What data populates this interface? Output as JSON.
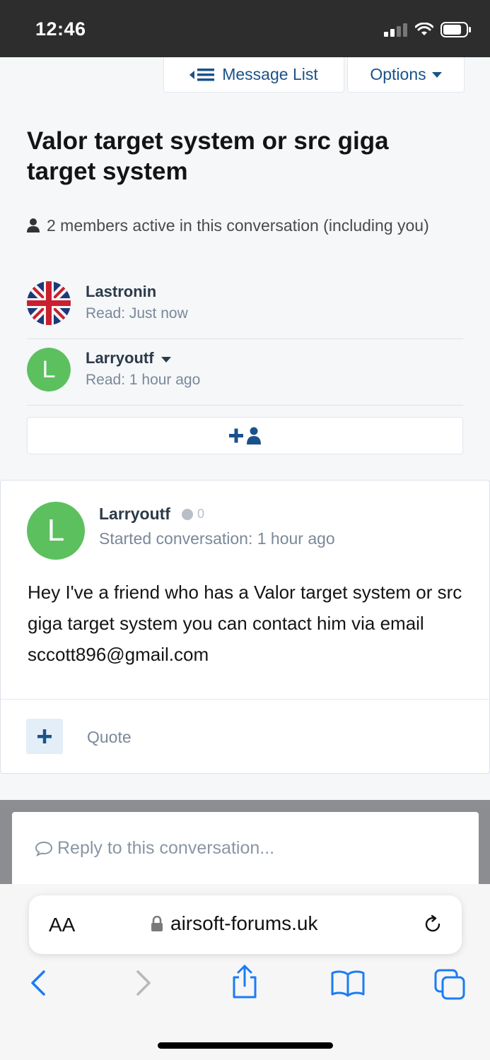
{
  "status_bar": {
    "time": "12:46"
  },
  "header": {
    "message_list_label": "Message List",
    "options_label": "Options"
  },
  "conversation": {
    "title": "Valor target system or src giga target system",
    "members_text": "2 members active in this conversation (including you)",
    "members": [
      {
        "name": "Lastronin",
        "read": "Read: Just now"
      },
      {
        "name": "Larryoutf",
        "read": "Read: 1 hour ago",
        "avatar_letter": "L"
      }
    ]
  },
  "message": {
    "avatar_letter": "L",
    "author": "Larryoutf",
    "reaction_count": "0",
    "meta": "Started conversation: 1 hour ago",
    "body": "Hey I've a friend who has a Valor target system or src giga target system you can contact him via email sccott896@gmail.com",
    "quote_label": "Quote"
  },
  "reply": {
    "placeholder": "Reply to this conversation..."
  },
  "browser": {
    "aa_label": "AA",
    "url": "airsoft-forums.uk"
  },
  "colors": {
    "accent": "#1b5289",
    "avatar_green": "#5cc05f",
    "ios_blue": "#1a7cf5"
  }
}
